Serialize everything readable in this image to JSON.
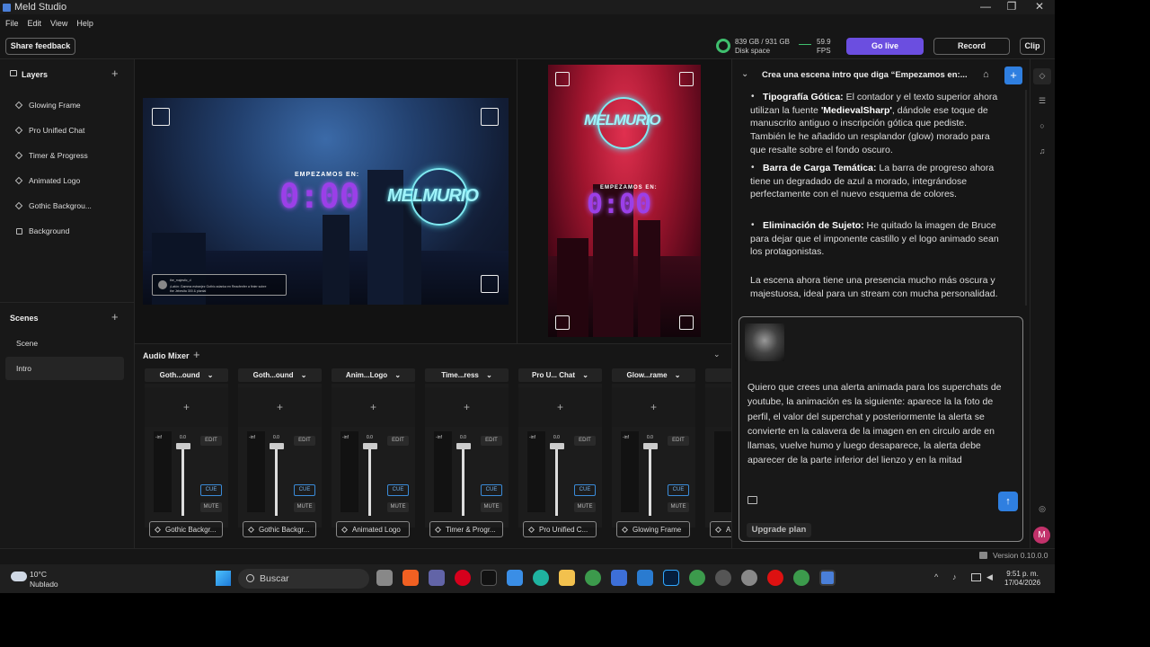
{
  "window": {
    "title": "Meld Studio",
    "min": "—",
    "max": "❐",
    "close": "✕"
  },
  "menu": [
    "File",
    "Edit",
    "View",
    "Help"
  ],
  "toolbar": {
    "share_feedback": "Share feedback",
    "disk_space_value": "839 GB / 931 GB",
    "disk_space_label": "Disk space",
    "fps_value": "59.9",
    "fps_label": "FPS",
    "go_live": "Go live",
    "record": "Record",
    "clip": "Clip"
  },
  "layers": {
    "title": "Layers",
    "items": [
      "Glowing Frame",
      "Pro Unified Chat",
      "Timer & Progress",
      "Animated Logo",
      "Gothic Backgrou...",
      "Background"
    ]
  },
  "scenes": {
    "title": "Scenes",
    "items": [
      "Scene",
      "Intro"
    ]
  },
  "preview": {
    "heading": "EMPEZAMOS EN:",
    "timer": "0:00",
    "logo_text": "MELMURIO",
    "chat_user": "the_majestic_d",
    "chat_line1": "¡Latón: Gamma estranjez Gothic adanka en Reacfenfer a finter sobre",
    "chat_line2": "the Jebesita 300 & plantal"
  },
  "mixer": {
    "title": "Audio Mixer",
    "channels": [
      {
        "name": "Goth...ound",
        "source": "Gothic Backgr...",
        "db": "0.0",
        "inf": "-inf",
        "edit": "EDIT",
        "cue": "CUE",
        "mute": "MUTE"
      },
      {
        "name": "Goth...ound",
        "source": "Gothic Backgr...",
        "db": "0.0",
        "inf": "-inf",
        "edit": "EDIT",
        "cue": "CUE",
        "mute": "MUTE"
      },
      {
        "name": "Anim...Logo",
        "source": "Animated Logo",
        "db": "0.0",
        "inf": "-inf",
        "edit": "EDIT",
        "cue": "CUE",
        "mute": "MUTE"
      },
      {
        "name": "Time...ress",
        "source": "Timer & Progr...",
        "db": "0.0",
        "inf": "-inf",
        "edit": "EDIT",
        "cue": "CUE",
        "mute": "MUTE"
      },
      {
        "name": "Pro U... Chat",
        "source": "Pro Unified C...",
        "db": "0.0",
        "inf": "-inf",
        "edit": "EDIT",
        "cue": "CUE",
        "mute": "MUTE"
      },
      {
        "name": "Glow...rame",
        "source": "Glowing Frame",
        "db": "0.0",
        "inf": "-inf",
        "edit": "EDIT",
        "cue": "CUE",
        "mute": "MUTE"
      },
      {
        "name": "A",
        "source": "A",
        "db": "",
        "inf": "",
        "edit": "",
        "cue": "",
        "mute": ""
      }
    ]
  },
  "chat": {
    "title": "Crea una escena intro que diga “Empezamos en:...",
    "bullets": [
      {
        "bold": "Tipografía Gótica:",
        "text": " El contador y el texto superior ahora utilizan la fuente ",
        "bold2": "'MedievalSharp'",
        "text2": ", dándole ese toque de manuscrito antiguo o inscripción gótica que pediste. También le he añadido un resplandor (glow) morado para que resalte sobre el fondo oscuro."
      },
      {
        "bold": "Barra de Carga Temática:",
        "text": " La barra de progreso ahora tiene un degradado de azul a morado, integrándose perfectamente con el nuevo esquema de colores.",
        "bold2": "",
        "text2": ""
      },
      {
        "bold": "Eliminación de Sujeto:",
        "text": " He quitado la imagen de Bruce para dejar que el imponente castillo y el logo animado sean los protagonistas.",
        "bold2": "",
        "text2": ""
      }
    ],
    "closing": "La escena ahora tiene una presencia mucho más oscura y majestuosa, ideal para un stream con mucha personalidad.",
    "input_text": "Quiero que crees una alerta animada para los superchats de youtube, la animación es la siguiente: aparece la la foto de perfil, el valor del superchat y posteriormente la alerta se convierte en la calavera de la imagen en en circulo arde en llamas, vuelve humo y luego desaparece, la alerta debe aparecer de la parte inferior del lienzo y en la mitad",
    "upgrade": "Upgrade plan",
    "avatar_letter": "M"
  },
  "status": {
    "version": "Version 0.10.0.0"
  },
  "taskbar": {
    "weather_temp": "10°C",
    "weather_desc": "Nublado",
    "search_placeholder": "Buscar",
    "time": "9:51 p. m.",
    "date": "17/04/2026"
  },
  "colors": {
    "accent": "#6b4ee0",
    "send": "#2f7fe0",
    "disk_ring": "#3fbf6e",
    "timer_purple": "#9b3fe8",
    "cue_blue": "#3a8bd8"
  }
}
